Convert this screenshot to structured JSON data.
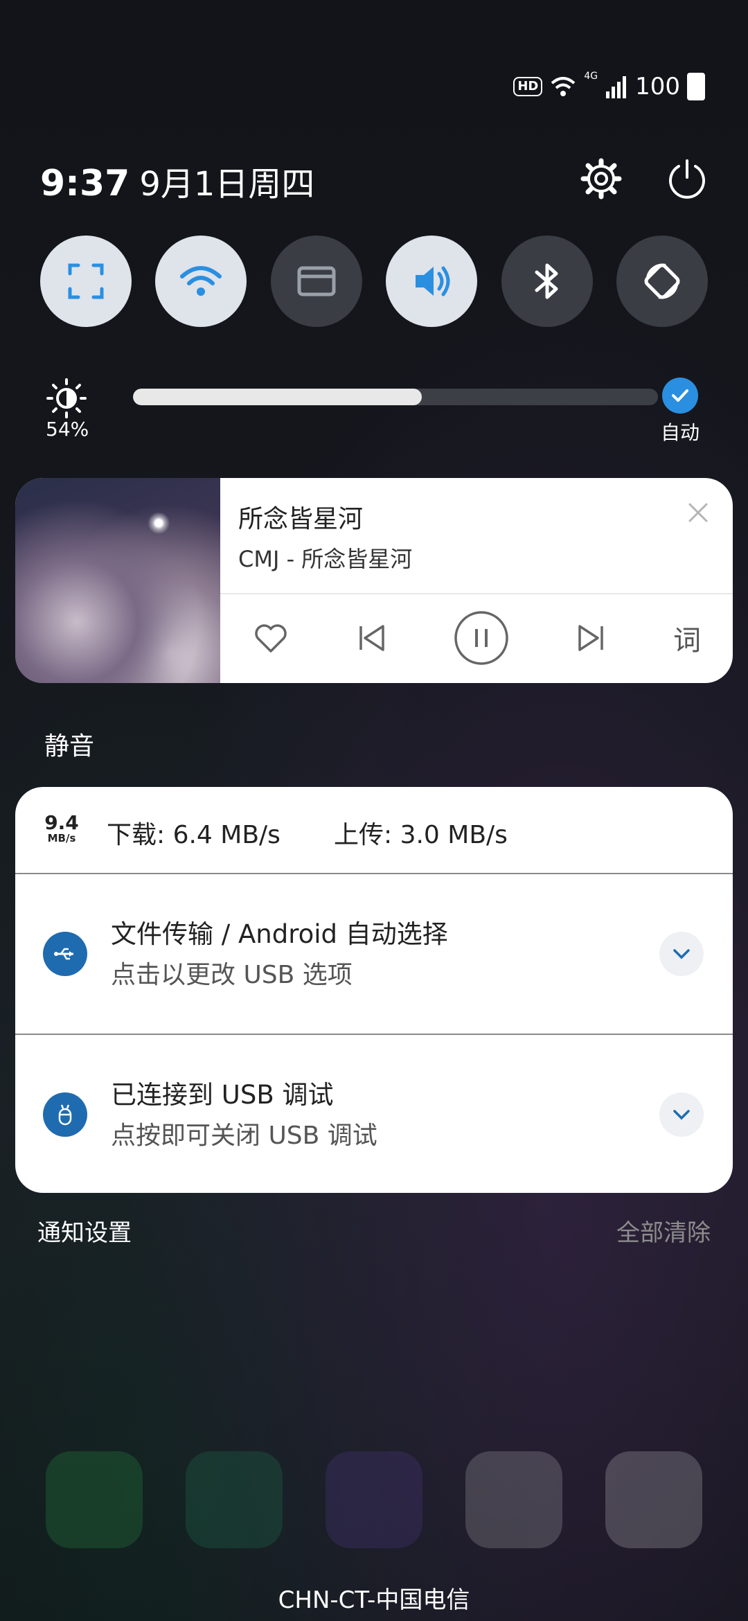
{
  "status_bar": {
    "hd": "HD",
    "network": "4G",
    "battery": "100"
  },
  "header": {
    "time": "9:37",
    "date": "9月1日周四",
    "settings_icon": "gear-icon",
    "power_icon": "power-icon"
  },
  "toggles": [
    {
      "name": "screenshot",
      "icon": "screenshot-icon",
      "on": true
    },
    {
      "name": "wifi",
      "icon": "wifi-icon",
      "on": true
    },
    {
      "name": "card",
      "icon": "card-icon",
      "on": false
    },
    {
      "name": "sound",
      "icon": "volume-icon",
      "on": true
    },
    {
      "name": "bluetooth",
      "icon": "bluetooth-icon",
      "on": false
    },
    {
      "name": "rotation",
      "icon": "rotation-icon",
      "on": false
    }
  ],
  "brightness": {
    "percent_label": "54%",
    "level": 0.55,
    "auto_label": "自动"
  },
  "media": {
    "title": "所念皆星河",
    "artist": "CMJ - 所念皆星河",
    "lyric_label": "词"
  },
  "mode_label": "静音",
  "notifications": {
    "speed_value": "9.4",
    "speed_unit": "MB/s",
    "download": "下载: 6.4 MB/s",
    "upload": "上传: 3.0 MB/s",
    "usb_transfer": {
      "title": "文件传输 / Android 自动选择",
      "subtitle": "点击以更改 USB 选项"
    },
    "usb_debug": {
      "title": "已连接到 USB 调试",
      "subtitle": "点按即可关闭 USB 调试"
    }
  },
  "footer": {
    "settings": "通知设置",
    "clear_all": "全部清除"
  },
  "carrier": "CHN-CT-中国电信",
  "colors": {
    "accent": "#2a8fe0",
    "toggle_on": "#dfe3ea",
    "toggle_off": "#3a3d44",
    "notif_icon": "#1e6bb0"
  }
}
